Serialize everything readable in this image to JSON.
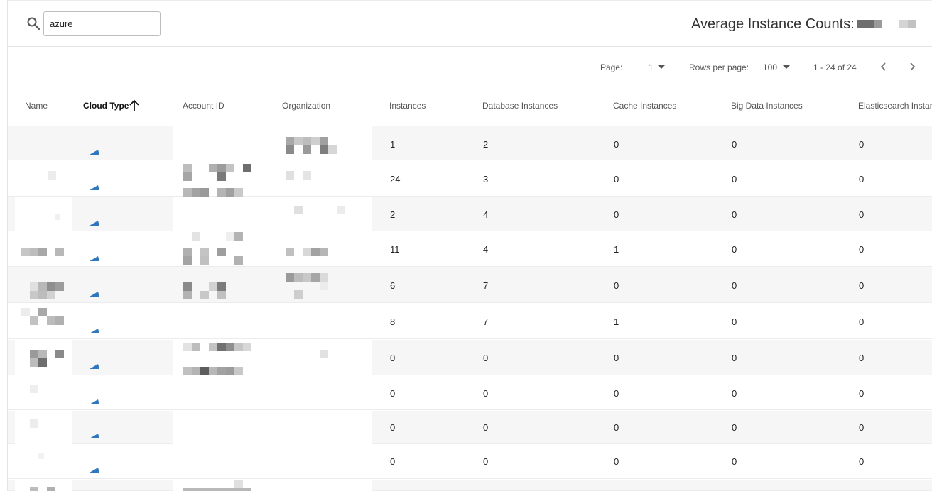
{
  "search": {
    "value": "azure"
  },
  "summary": {
    "label": "Average Instance Counts:"
  },
  "pagination": {
    "page_label": "Page:",
    "page_value": "1",
    "rows_label": "Rows per page:",
    "rows_value": "100",
    "range_text": "1 - 24 of 24"
  },
  "table": {
    "columns": [
      "Name",
      "Cloud Type",
      "Account ID",
      "Organization",
      "Instances",
      "Database Instances",
      "Cache Instances",
      "Big Data Instances",
      "Elasticsearch Instances"
    ],
    "sorted_column": "Cloud Type",
    "sort_direction": "ascending",
    "rows": [
      {
        "cloud_type": "azure-icon",
        "instances": "1",
        "database_instances": "2",
        "cache_instances": "0",
        "big_data_instances": "0",
        "elasticsearch_instances": "0"
      },
      {
        "cloud_type": "azure-icon",
        "instances": "24",
        "database_instances": "3",
        "cache_instances": "0",
        "big_data_instances": "0",
        "elasticsearch_instances": "0"
      },
      {
        "cloud_type": "azure-icon",
        "instances": "2",
        "database_instances": "4",
        "cache_instances": "0",
        "big_data_instances": "0",
        "elasticsearch_instances": "0"
      },
      {
        "cloud_type": "azure-icon",
        "instances": "11",
        "database_instances": "4",
        "cache_instances": "1",
        "big_data_instances": "0",
        "elasticsearch_instances": "0"
      },
      {
        "cloud_type": "azure-icon",
        "instances": "6",
        "database_instances": "7",
        "cache_instances": "0",
        "big_data_instances": "0",
        "elasticsearch_instances": "0"
      },
      {
        "cloud_type": "azure-icon",
        "instances": "8",
        "database_instances": "7",
        "cache_instances": "1",
        "big_data_instances": "0",
        "elasticsearch_instances": "0"
      },
      {
        "cloud_type": "azure-icon",
        "instances": "0",
        "database_instances": "0",
        "cache_instances": "0",
        "big_data_instances": "0",
        "elasticsearch_instances": "0"
      },
      {
        "cloud_type": "azure-icon",
        "instances": "0",
        "database_instances": "0",
        "cache_instances": "0",
        "big_data_instances": "0",
        "elasticsearch_instances": "0"
      },
      {
        "cloud_type": "azure-icon",
        "instances": "0",
        "database_instances": "0",
        "cache_instances": "0",
        "big_data_instances": "0",
        "elasticsearch_instances": "0"
      },
      {
        "cloud_type": "azure-icon",
        "instances": "0",
        "database_instances": "0",
        "cache_instances": "0",
        "big_data_instances": "0",
        "elasticsearch_instances": "0"
      },
      {
        "cloud_type": "azure-icon",
        "instances": "",
        "database_instances": "",
        "cache_instances": "",
        "big_data_instances": "",
        "elasticsearch_instances": ""
      }
    ]
  },
  "colors": {
    "azure_dark": "#0a5cad",
    "azure_light": "#2ea7e8",
    "row_shade": "#f6f6f6",
    "redaction_dark": "#6e6e6e",
    "redaction_light": "#d0d0d0"
  }
}
